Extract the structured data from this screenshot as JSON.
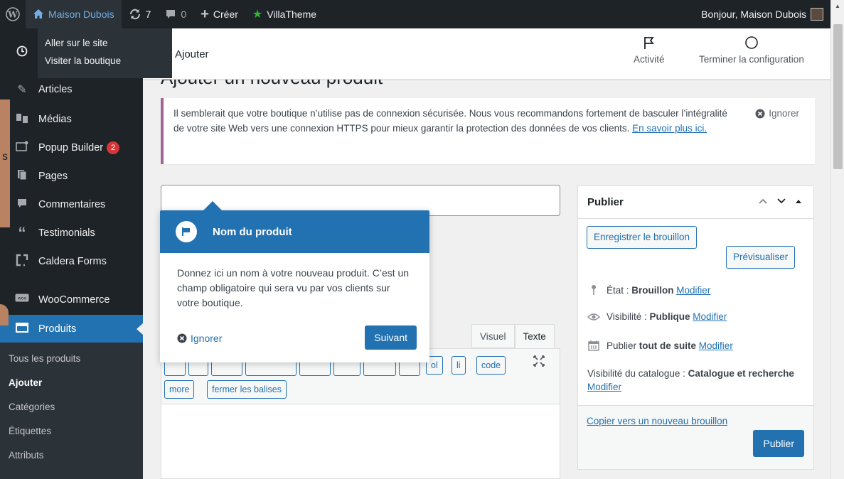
{
  "adminbar": {
    "site_name": "Maison Dubois",
    "updates_count": "7",
    "comments_count": "0",
    "new_label": "Créer",
    "villatheme_label": "VillaTheme",
    "greeting": "Bonjour, Maison Dubois"
  },
  "site_dropdown": {
    "items": [
      "Aller sur le site",
      "Visiter la boutique"
    ]
  },
  "menu": {
    "items": [
      {
        "label": "Articles",
        "icon": "pin-icon"
      },
      {
        "label": "Médias",
        "icon": "media-icon"
      },
      {
        "label": "Popup Builder",
        "icon": "popup-icon",
        "badge": "2"
      },
      {
        "label": "Pages",
        "icon": "pages-icon"
      },
      {
        "label": "Commentaires",
        "icon": "comments-icon"
      },
      {
        "label": "Testimonials",
        "icon": "quote-icon"
      },
      {
        "label": "Caldera Forms",
        "icon": "forms-icon"
      },
      {
        "label": "WooCommerce",
        "icon": "woo-icon"
      },
      {
        "label": "Produits",
        "icon": "products-icon"
      }
    ],
    "submenu": [
      "Tous les produits",
      "Ajouter",
      "Catégories",
      "Étiquettes",
      "Attributs"
    ]
  },
  "overlay_text": "s",
  "wc_header": {
    "title": "Ajouter",
    "activity_label": "Activité",
    "setup_label": "Terminer la configuration"
  },
  "page_title": "Ajouter un nouveau produit",
  "notice": {
    "text": "Il semblerait que votre boutique n’utilise pas de connexion sécurisée. Nous vous recommandons fortement de basculer l’intégralité de votre site Web vers une connexion HTTPS pour mieux garantir la protection des données de vos clients.",
    "link": "En savoir plus ici.",
    "dismiss": "Ignorer"
  },
  "tour": {
    "title": "Nom du produit",
    "body": "Donnez ici un nom à votre nouveau produit. C’est un champ obligatoire qui sera vu par vos clients sur votre boutique.",
    "dismiss": "Ignorer",
    "next": "Suivant"
  },
  "editor": {
    "tab_visual": "Visuel",
    "tab_text": "Texte",
    "buttons": [
      "ol",
      "li",
      "code",
      "more",
      "fermer les balises"
    ]
  },
  "publish": {
    "title": "Publier",
    "save_draft": "Enregistrer le brouillon",
    "preview": "Prévisualiser",
    "status_label": "État : ",
    "status_value": "Brouillon",
    "visibility_label": "Visibilité : ",
    "visibility_value": "Publique",
    "publish_label": "Publier ",
    "publish_value": "tout de suite",
    "edit_link": "Modifier",
    "catalog_label": "Visibilité du catalogue : ",
    "catalog_value": "Catalogue et recherche",
    "copy_draft": "Copier vers un nouveau brouillon",
    "publish_button": "Publier"
  },
  "colors": {
    "admin_dark": "#1d2327",
    "accent_blue": "#2271b1",
    "notice_purple": "#a16696",
    "badge_red": "#d63638"
  }
}
